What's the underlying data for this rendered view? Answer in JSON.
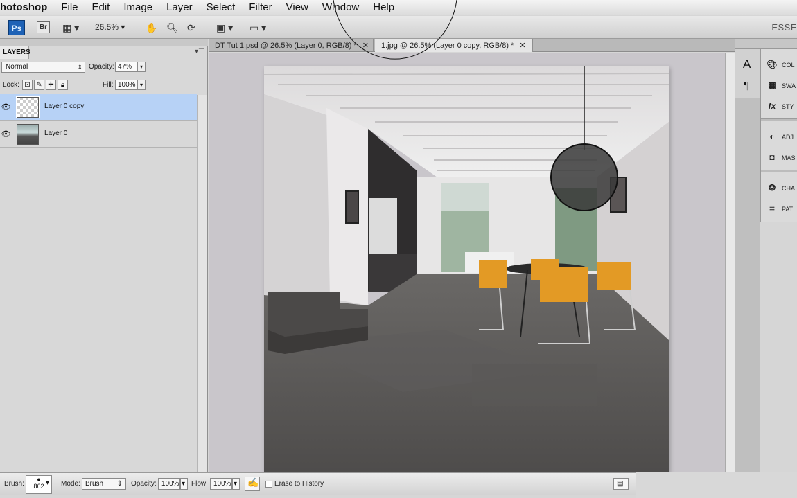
{
  "menu": {
    "app_name": "hotoshop",
    "items": [
      "File",
      "Edit",
      "Image",
      "Layer",
      "Select",
      "Filter",
      "View",
      "Window",
      "Help"
    ]
  },
  "appbar": {
    "ps_label": "Ps",
    "br_label": "Br",
    "zoom": "26.5%",
    "workspace": "ESSE"
  },
  "layers_panel": {
    "tab_label": "LAYERS",
    "blend_mode": "Normal",
    "opacity_label": "Opacity:",
    "opacity_value": "47%",
    "lock_label": "Lock:",
    "fill_label": "Fill:",
    "fill_value": "100%",
    "layers": [
      {
        "name": "Layer 0 copy",
        "selected": true,
        "visible": true
      },
      {
        "name": "Layer 0",
        "selected": false,
        "visible": true
      }
    ]
  },
  "doc_tabs": [
    {
      "label": "DT Tut 1.psd @ 26.5% (Layer 0, RGB/8) *",
      "active": false
    },
    {
      "label": "1.jpg @ 26.5% (Layer 0 copy, RGB/8) *",
      "active": true
    }
  ],
  "right_panels": [
    {
      "icon": "color-icon",
      "label": "COL"
    },
    {
      "icon": "swatches-icon",
      "label": "SWA"
    },
    {
      "icon": "styles-icon",
      "label": "STY"
    },
    {
      "icon": "adjustments-icon",
      "label": "ADJ"
    },
    {
      "icon": "masks-icon",
      "label": "MAS"
    },
    {
      "icon": "channels-icon",
      "label": "CHA"
    },
    {
      "icon": "paths-icon",
      "label": "PAT"
    }
  ],
  "brush_bar": {
    "brush_label": "Brush:",
    "brush_size": "862",
    "mode_label": "Mode:",
    "mode_value": "Brush",
    "opacity_label": "Opacity:",
    "opacity_value": "100%",
    "flow_label": "Flow:",
    "flow_value": "100%",
    "erase_history_label": "Erase to History"
  },
  "colors": {
    "selected_layer": "#b7d2f6",
    "ps_blue": "#1e62b6",
    "chair_orange": "#e39a25"
  }
}
